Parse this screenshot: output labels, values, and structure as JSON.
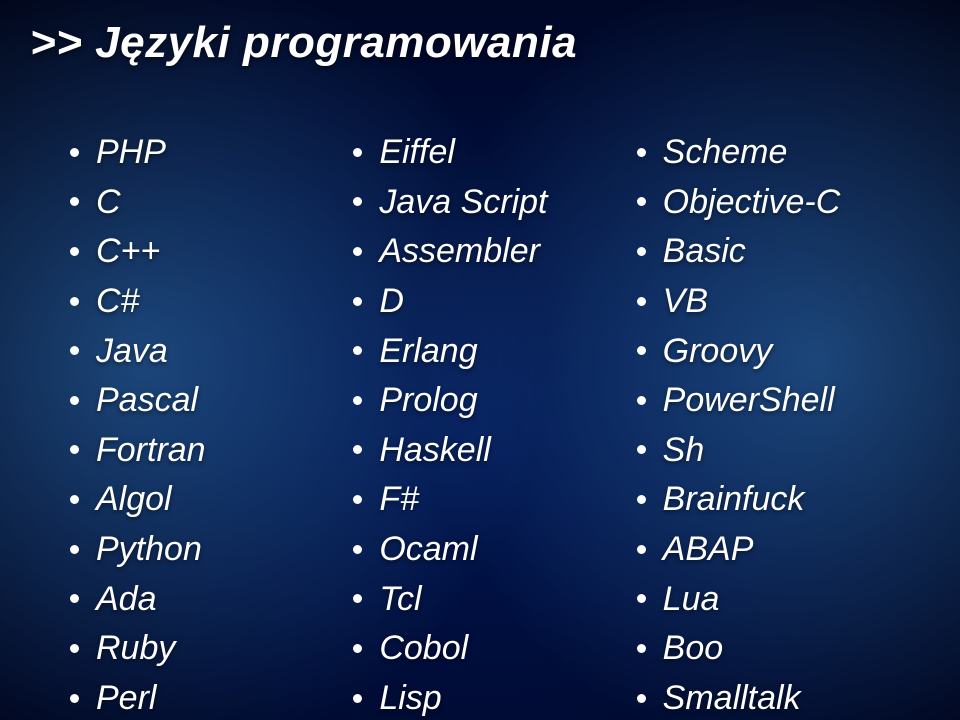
{
  "title_prefix": ">> ",
  "title": "Języki programowania",
  "columns": [
    [
      "PHP",
      "C",
      "C++",
      "C#",
      "Java",
      "Pascal",
      "Fortran",
      "Algol",
      "Python",
      "Ada",
      "Ruby",
      "Perl"
    ],
    [
      "Eiffel",
      "Java Script",
      "Assembler",
      "D",
      "Erlang",
      "Prolog",
      "Haskell",
      "F#",
      "Ocaml",
      "Tcl",
      "Cobol",
      "Lisp"
    ],
    [
      "Scheme",
      "Objective-C",
      "Basic",
      "VB",
      "Groovy",
      "PowerShell",
      "Sh",
      "Brainfuck",
      "ABAP",
      "Lua",
      "Boo",
      "Smalltalk"
    ]
  ]
}
